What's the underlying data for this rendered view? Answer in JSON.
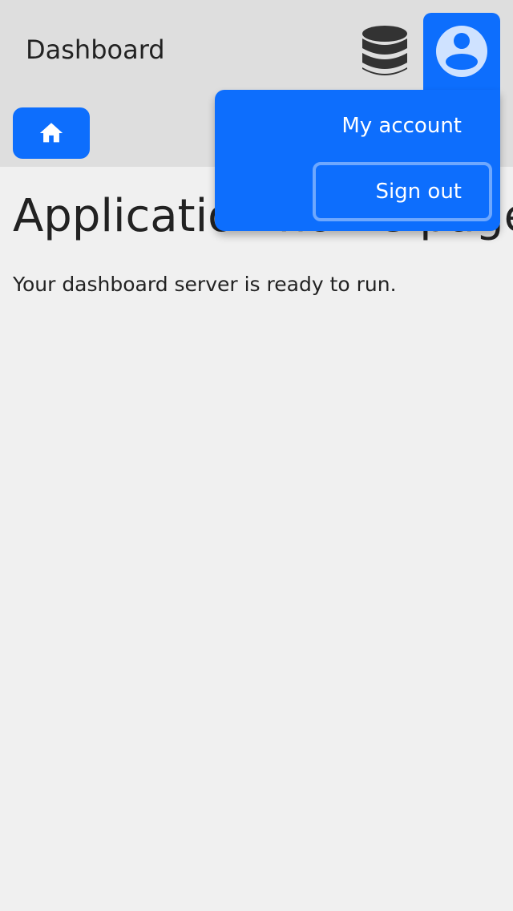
{
  "header": {
    "title": "Dashboard",
    "database_icon": "database-icon",
    "user_icon": "account-circle-icon"
  },
  "nav": {
    "home_icon": "home-icon"
  },
  "user_menu": {
    "items": [
      {
        "label": "My account"
      },
      {
        "label": "Sign out"
      }
    ]
  },
  "main": {
    "heading": "Application home page",
    "text": "Your dashboard server is ready to run."
  },
  "colors": {
    "primary": "#0d6efd",
    "focus_ring": "#6ea8fe",
    "header_bg": "#dedede",
    "page_bg": "#f0f0f0",
    "icon_dark": "#333333",
    "avatar_fill": "#cfe2ff"
  }
}
